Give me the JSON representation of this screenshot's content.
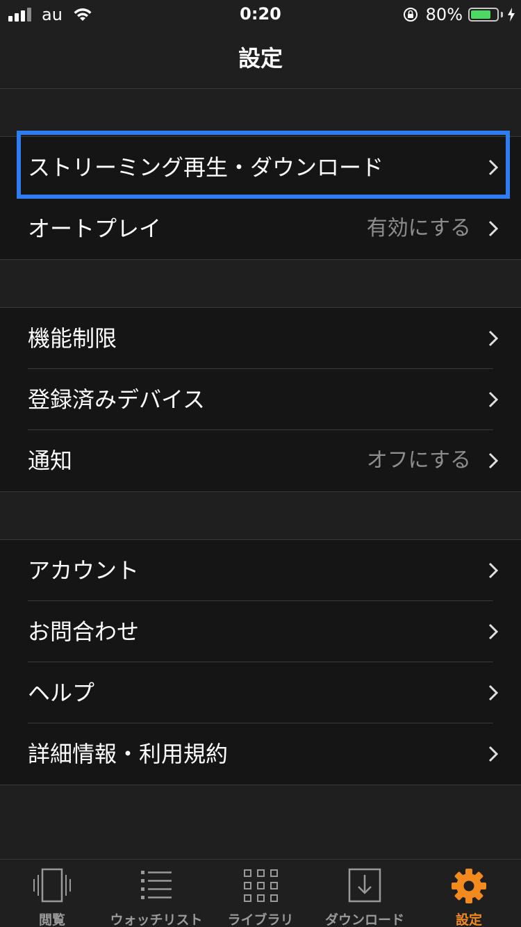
{
  "status_bar": {
    "carrier": "au",
    "time": "0:20",
    "battery_percent": "80%",
    "battery_level": 0.8,
    "icons": [
      "signal-icon",
      "wifi-icon",
      "rotation-lock-icon",
      "battery-icon",
      "charging-icon"
    ]
  },
  "nav": {
    "title": "設定"
  },
  "sections": {
    "playback": {
      "streaming_label": "ストリーミング再生・ダウンロード",
      "autoplay_label": "オートプレイ",
      "autoplay_value": "有効にする"
    },
    "device": {
      "restriction_label": "機能制限",
      "devices_label": "登録済みデバイス",
      "notify_label": "通知",
      "notify_value": "オフにする"
    },
    "info": {
      "account_label": "アカウント",
      "contact_label": "お問合わせ",
      "help_label": "ヘルプ",
      "terms_label": "詳細情報・利用規約"
    }
  },
  "tabs": [
    {
      "label": "閲覧",
      "icon": "browse-icon",
      "active": false
    },
    {
      "label": "ウォッチリスト",
      "icon": "watchlist-icon",
      "active": false
    },
    {
      "label": "ライブラリ",
      "icon": "library-icon",
      "active": false
    },
    {
      "label": "ダウンロード",
      "icon": "download-icon",
      "active": false
    },
    {
      "label": "設定",
      "icon": "gear-icon",
      "active": true
    }
  ],
  "colors": {
    "background": "#1f1f1f",
    "section_background": "#151515",
    "highlight_border": "#2f7df0",
    "active_tab": "#f28a1e",
    "secondary_text": "#8e8e8e",
    "battery_fill": "#4cd964"
  }
}
